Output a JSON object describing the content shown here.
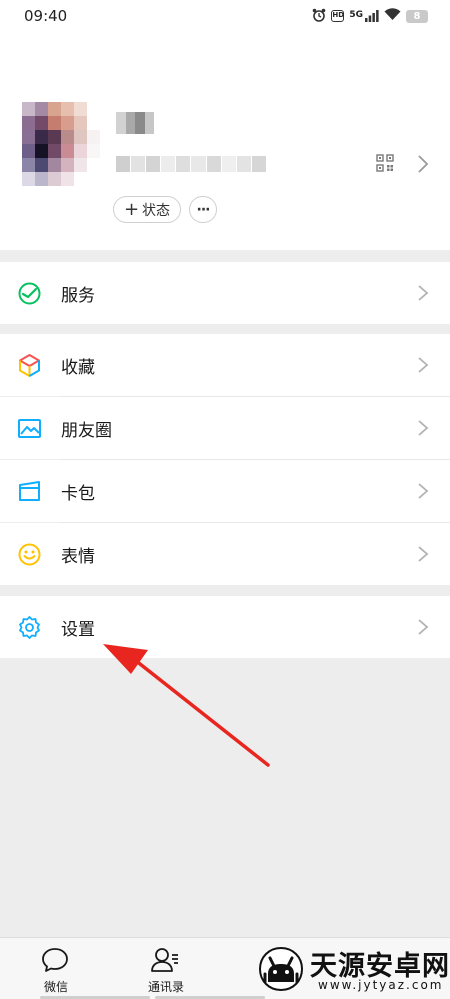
{
  "status_bar": {
    "time": "09:40",
    "hd_label": "HD",
    "network": "5G",
    "battery": "8"
  },
  "profile": {
    "status_button": "状态",
    "more_button": "···"
  },
  "menu": {
    "services": "服务",
    "favorites": "收藏",
    "moments": "朋友圈",
    "cards": "卡包",
    "stickers": "表情",
    "settings": "设置"
  },
  "tabbar": {
    "chats": "微信",
    "contacts": "通讯录"
  },
  "watermark": {
    "name": "天源安卓网",
    "url": "www.jytyaz.com"
  },
  "colors": {
    "accent_green": "#07c160",
    "annotation_red": "#e8261f"
  }
}
